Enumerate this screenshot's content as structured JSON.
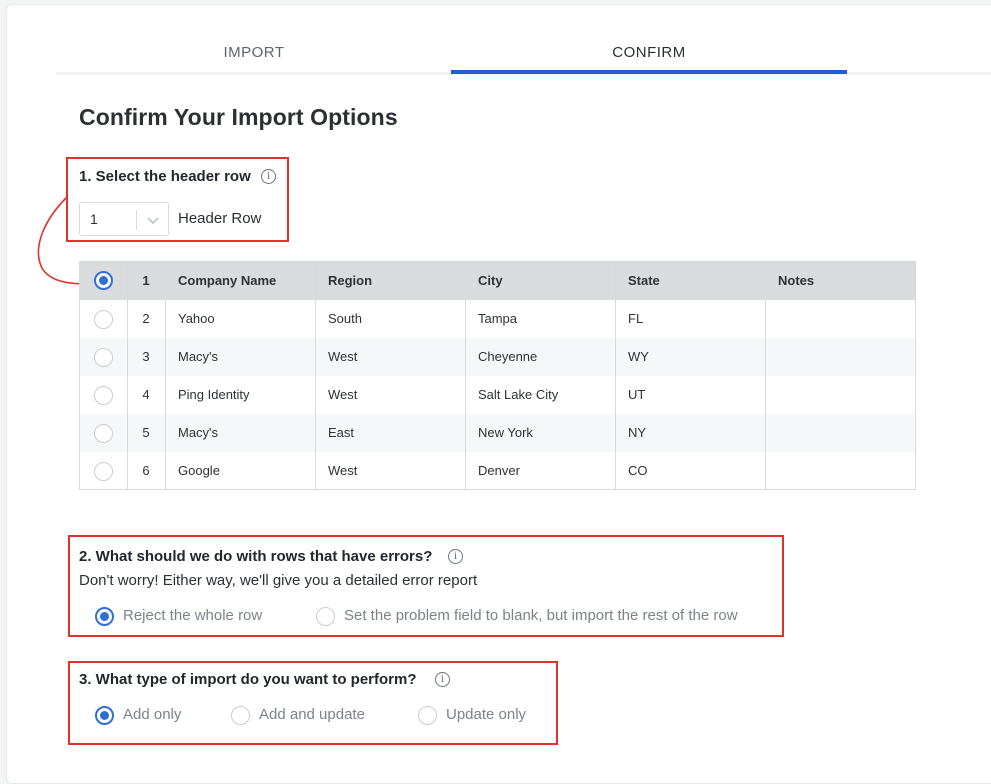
{
  "tabs": [
    {
      "label": "IMPORT"
    },
    {
      "label": "CONFIRM"
    }
  ],
  "title": "Confirm Your Import Options",
  "section1": {
    "label": "1. Select the header row",
    "selected_value": "1",
    "suffix": "Header Row"
  },
  "table": {
    "headers": [
      "1",
      "Company Name",
      "Region",
      "City",
      "State",
      "Notes"
    ],
    "rows": [
      {
        "num": "2",
        "company": "Yahoo",
        "region": "South",
        "city": "Tampa",
        "state": "FL",
        "notes": ""
      },
      {
        "num": "3",
        "company": "Macy's",
        "region": "West",
        "city": "Cheyenne",
        "state": "WY",
        "notes": ""
      },
      {
        "num": "4",
        "company": "Ping Identity",
        "region": "West",
        "city": "Salt Lake City",
        "state": "UT",
        "notes": ""
      },
      {
        "num": "5",
        "company": "Macy's",
        "region": "East",
        "city": "New York",
        "state": "NY",
        "notes": ""
      },
      {
        "num": "6",
        "company": "Google",
        "region": "West",
        "city": "Denver",
        "state": "CO",
        "notes": ""
      }
    ]
  },
  "section2": {
    "label": "2. What should we do with rows that have errors?",
    "subtext": "Don't worry! Either way, we'll give you a detailed error report",
    "options": [
      "Reject the whole row",
      "Set the problem field to blank, but import the rest of the row"
    ],
    "selected": "Reject the whole row"
  },
  "section3": {
    "label": "3. What type of import do you want to perform?",
    "options": [
      "Add only",
      "Add and update",
      "Update only"
    ],
    "selected": "Add only"
  },
  "info_glyph": "i",
  "colors": {
    "accent": "#2f6fd4",
    "highlight_box": "#e0322d",
    "tab_active": "#1f5fcf"
  }
}
